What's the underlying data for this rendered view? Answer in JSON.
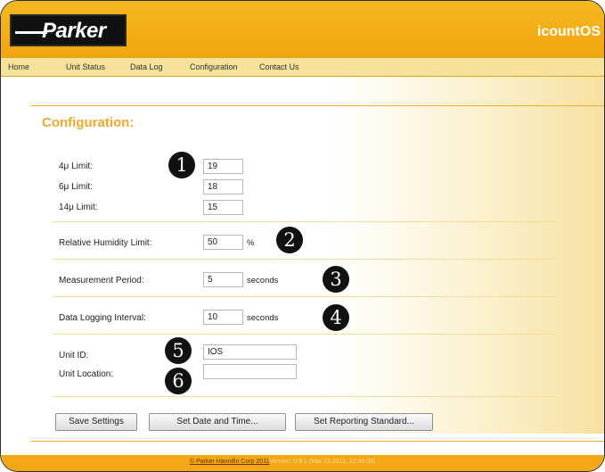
{
  "header": {
    "logo_text": "Parker",
    "app_name": "icountOS"
  },
  "nav": {
    "items": [
      "Home",
      "Unit Status",
      "Data Log",
      "Configuration",
      "Contact Us"
    ]
  },
  "page": {
    "title": "Configuration:"
  },
  "limits": {
    "four_label": "4μ Limit:",
    "four_value": "19",
    "six_label": "6μ Limit:",
    "six_value": "18",
    "fourteen_label": "14μ Limit:",
    "fourteen_value": "15"
  },
  "humidity": {
    "label": "Relative Humidity Limit:",
    "value": "50",
    "unit": "%"
  },
  "measurement": {
    "label": "Measurement Period:",
    "value": "5",
    "unit": "seconds"
  },
  "logging": {
    "label": "Data Logging Interval:",
    "value": "10",
    "unit": "seconds"
  },
  "unit_info": {
    "id_label": "Unit ID:",
    "id_value": "IOS",
    "location_label": "Unit Location:",
    "location_value": ""
  },
  "callouts": [
    "1",
    "2",
    "3",
    "4",
    "5",
    "6"
  ],
  "buttons": {
    "save": "Save Settings",
    "date_time": "Set Date and Time...",
    "reporting": "Set Reporting Standard..."
  },
  "footer": {
    "copyright": "© Parker Hannifin Corp 2011",
    "version": "Version: 0.9.1 (Mar 13 2011, 22:48:09)"
  },
  "colors": {
    "accent": "#f2a60e",
    "title": "#f0a82a",
    "nav_bg": "#f6e29a"
  }
}
